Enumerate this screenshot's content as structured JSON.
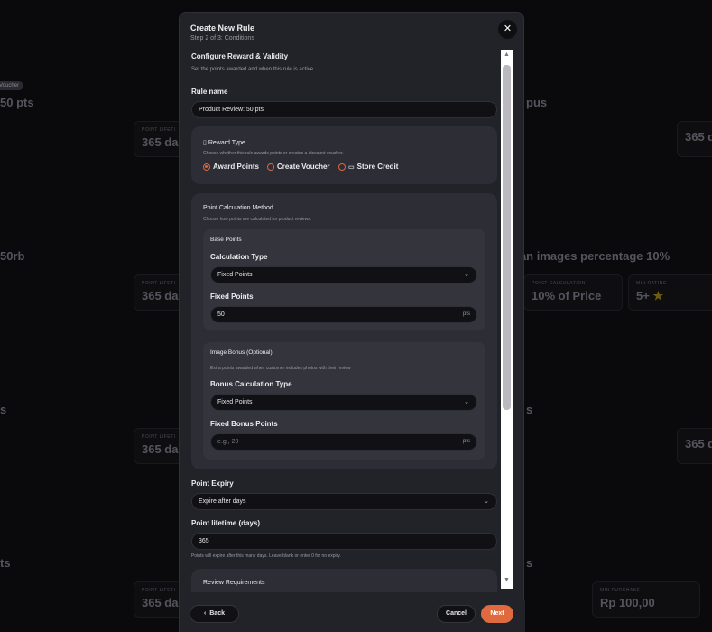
{
  "background": {
    "pill": "Voucher",
    "titles": [
      "50 pts",
      "pus",
      "50rb",
      "gan images percentage 10%",
      "s",
      "s",
      "ts",
      "s"
    ],
    "cards": [
      {
        "label": "POINT LIFETI",
        "value": "365 da"
      },
      {
        "label": "",
        "value": "365 d"
      },
      {
        "label": "POINT LIFETI",
        "value": "365 da"
      },
      {
        "label": "POINT CALCULATION",
        "value": "10% of Price"
      },
      {
        "label": "MIN RATING",
        "value": "5+"
      },
      {
        "label": "POINT LIFETI",
        "value": "365 da"
      },
      {
        "label": "",
        "value": "365 d"
      },
      {
        "label": "POINT LIFETI",
        "value": "365 da"
      },
      {
        "label": "MIN PURCHASE",
        "value": "Rp 100,00"
      }
    ]
  },
  "modal": {
    "title": "Create New Rule",
    "subtitle": "Step 2 of 3: Conditions",
    "close_icon": "close-icon",
    "section_title": "Configure Reward & Validity",
    "section_desc": "Set the points awarded and when this rule is active.",
    "rule_name_label": "Rule name",
    "rule_name_value": "Product Review: 50 pts",
    "reward_type": {
      "title": "Reward Type",
      "desc": "Choose whether this rule awards points or creates a discount voucher.",
      "options": [
        "Award Points",
        "Create Voucher",
        "Store Credit"
      ],
      "selected": "Award Points"
    },
    "point_calc": {
      "title": "Point Calculation Method",
      "desc": "Choose how points are calculated for product reviews.",
      "base": {
        "title": "Base Points",
        "calc_type_label": "Calculation Type",
        "calc_type_value": "Fixed Points",
        "fixed_label": "Fixed Points",
        "fixed_value": "50",
        "unit": "pts"
      },
      "bonus": {
        "title": "Image Bonus (Optional)",
        "desc": "Extra points awarded when customer includes photos with their review",
        "calc_type_label": "Bonus Calculation Type",
        "calc_type_value": "Fixed Points",
        "fixed_label": "Fixed Bonus Points",
        "fixed_placeholder": "e.g., 20",
        "unit": "pts"
      }
    },
    "expiry_label": "Point Expiry",
    "expiry_value": "Expire after days",
    "lifetime_label": "Point lifetime (days)",
    "lifetime_value": "365",
    "lifetime_hint": "Points will expire after this many days. Leave blank or enter 0 for no expiry.",
    "review_req_title": "Review Requirements",
    "buttons": {
      "back": "Back",
      "cancel": "Cancel",
      "next": "Next"
    }
  },
  "colors": {
    "accent": "#e2653a",
    "modal_bg": "#222229",
    "panel_bg": "#2d2d35"
  }
}
